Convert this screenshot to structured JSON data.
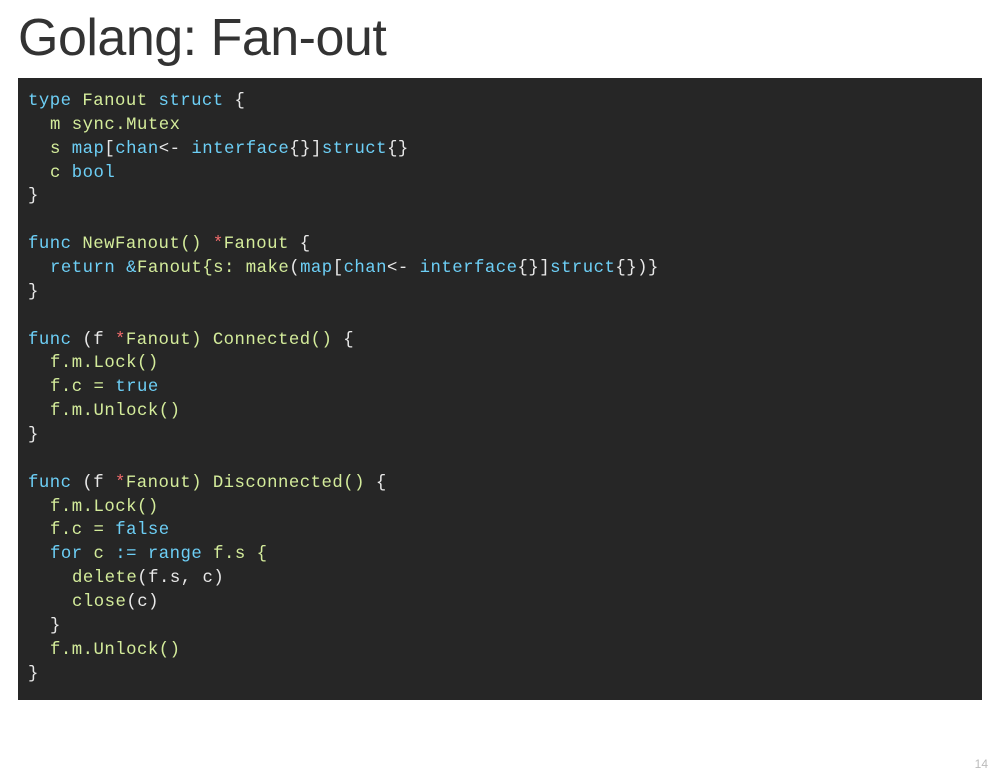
{
  "slide": {
    "title": "Golang: Fan-out",
    "page_number": "14"
  },
  "code": {
    "l01_type": "type",
    "l01_name": " Fanout ",
    "l01_struct": "struct",
    "l01_brace": " {",
    "l02_field": "m sync.Mutex",
    "l03_field_s": "s ",
    "l03_map": "map",
    "l03_bracket1": "[",
    "l03_chan": "chan",
    "l03_arrow": "<- ",
    "l03_interface": "interface",
    "l03_iface_braces": "{}]",
    "l03_struct": "struct",
    "l03_end": "{}",
    "l04_field_c": "c ",
    "l04_bool": "bool",
    "l05_close": "}",
    "l07_func": "func",
    "l07_name": " NewFanout() ",
    "l07_star": "*",
    "l07_type": "Fanout ",
    "l07_brace": "{",
    "l08_return": "return",
    "l08_sp1": " ",
    "l08_amp": "&",
    "l08_fanout": "Fanout{s: ",
    "l08_make": "make",
    "l08_paren1": "(",
    "l08_map": "map",
    "l08_b1": "[",
    "l08_chan": "chan",
    "l08_arrow": "<- ",
    "l08_interface": "interface",
    "l08_braces": "{}]",
    "l08_struct": "struct",
    "l08_end": "{})}",
    "l09_close": "}",
    "l11_func": "func",
    "l11_recv_open": " (f ",
    "l11_star": "*",
    "l11_type": "Fanout) ",
    "l11_name": "Connected() ",
    "l11_brace": "{",
    "l12_lock": "f.m.Lock()",
    "l13_assign": "f.c = ",
    "l13_true": "true",
    "l14_unlock": "f.m.Unlock()",
    "l15_close": "}",
    "l17_func": "func",
    "l17_recv_open": " (f ",
    "l17_star": "*",
    "l17_type": "Fanout) ",
    "l17_name": "Disconnected() ",
    "l17_brace": "{",
    "l18_lock": "f.m.Lock()",
    "l19_assign": "f.c = ",
    "l19_false": "false",
    "l20_for": "for",
    "l20_c": " c ",
    "l20_coloneq": ":=",
    "l20_sp": " ",
    "l20_range": "range",
    "l20_fs": " f.s {",
    "l21_delete": "delete",
    "l21_args": "(f.s, c)",
    "l22_close_fn": "close",
    "l22_args": "(c)",
    "l23_close": "}",
    "l24_unlock": "f.m.Unlock()",
    "l25_close": "}"
  }
}
